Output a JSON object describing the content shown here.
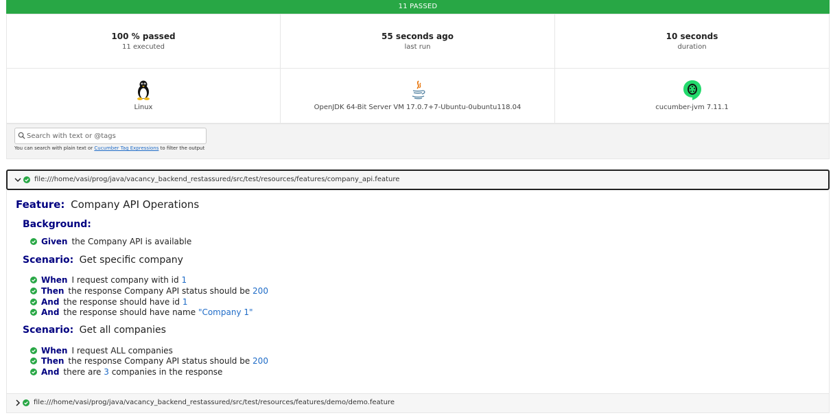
{
  "banner": "11 PASSED",
  "summary": {
    "passed": {
      "big": "100 % passed",
      "small": "11 executed"
    },
    "last_run": {
      "big": "55 seconds ago",
      "small": "last run"
    },
    "duration": {
      "big": "10 seconds",
      "small": "duration"
    }
  },
  "env": {
    "os": "Linux",
    "jvm": "OpenJDK 64-Bit Server VM 17.0.7+7-Ubuntu-0ubuntu118.04",
    "runner": "cucumber-jvm 7.11.1"
  },
  "search": {
    "placeholder": "Search with text or @tags",
    "help_prefix": "You can search with plain text or",
    "help_link": "Cucumber Tag Expressions",
    "help_suffix": "to filter the output"
  },
  "features": [
    {
      "path": "file:///home/vasi/prog/java/vacancy_backend_restassured/src/test/resources/features/company_api.feature",
      "keyword": "Feature:",
      "name": "Company API Operations",
      "background": {
        "keyword": "Background:",
        "steps": [
          {
            "keyword": "Given",
            "text": "the Company API is available",
            "arg": ""
          }
        ]
      },
      "scenarios": [
        {
          "keyword": "Scenario:",
          "name": "Get specific company",
          "steps": [
            {
              "keyword": "When",
              "text": "I request company with id",
              "arg": "1",
              "after": ""
            },
            {
              "keyword": "Then",
              "text": "the response Company API status should be",
              "arg": "200",
              "after": ""
            },
            {
              "keyword": "And",
              "text": "the response should have id",
              "arg": "1",
              "after": ""
            },
            {
              "keyword": "And",
              "text": "the response should have name",
              "arg": "\"Company 1\"",
              "after": ""
            }
          ]
        },
        {
          "keyword": "Scenario:",
          "name": "Get all companies",
          "steps": [
            {
              "keyword": "When",
              "text": "I request ALL companies",
              "arg": "",
              "after": ""
            },
            {
              "keyword": "Then",
              "text": "the response Company API status should be",
              "arg": "200",
              "after": ""
            },
            {
              "keyword": "And",
              "text": "there are",
              "arg": "3",
              "after": "companies in the response"
            }
          ]
        }
      ]
    },
    {
      "path": "file:///home/vasi/prog/java/vacancy_backend_restassured/src/test/resources/features/demo/demo.feature"
    }
  ],
  "colors": {
    "passed": "#28a745",
    "keyword": "#000080",
    "argument": "#1e6bc7"
  }
}
